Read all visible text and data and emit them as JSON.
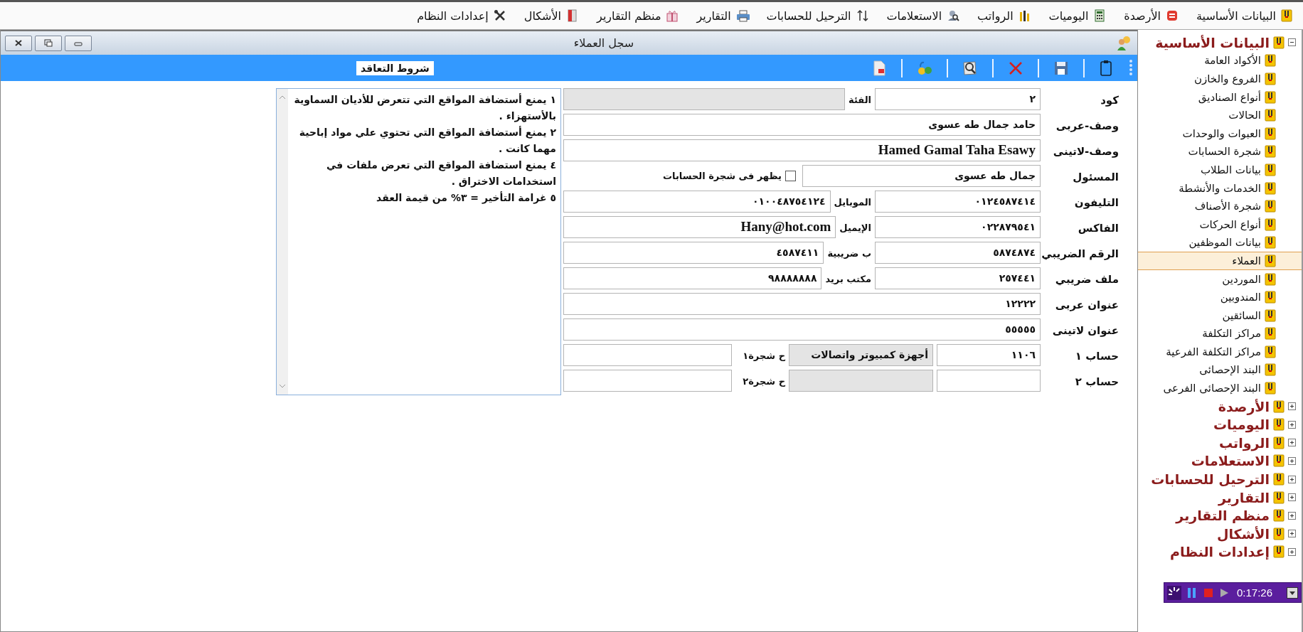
{
  "menu": [
    {
      "label": "البيانات الأساسية"
    },
    {
      "label": "الأرصدة"
    },
    {
      "label": "اليوميات"
    },
    {
      "label": "الرواتب"
    },
    {
      "label": "الاستعلامات"
    },
    {
      "label": "الترحيل للحسابات"
    },
    {
      "label": "التقارير"
    },
    {
      "label": "منظم التقارير"
    },
    {
      "label": "الأشكال"
    },
    {
      "label": "إعدادات النظام"
    }
  ],
  "window": {
    "title": "سجل العملاء"
  },
  "toolbar": {
    "section_label": "شروط التعاقد"
  },
  "form": {
    "rows": [
      {
        "kind": "pair",
        "label": "كود",
        "value": "٢",
        "side_label": "الفئة",
        "side_disabled": true
      },
      {
        "kind": "wide",
        "label": "وصف-عربى",
        "value": "حامد جمال طه عسوى"
      },
      {
        "kind": "wide",
        "label": "وصف-لاتينى",
        "value": "Hamed Gamal Taha Esawy",
        "latin": true
      },
      {
        "kind": "check",
        "label": "المسئول",
        "value": "جمال طه عسوى",
        "check_label": "يظهر فى شجرة الحسابات",
        "checked": false
      },
      {
        "kind": "pair",
        "label": "التليفون",
        "value": "٠١٢٤٥٨٧٤١٤",
        "side_label": "الموبايل",
        "side_value": "٠١٠٠٤٨٧٥٤١٢٤",
        "side_disabled": false
      },
      {
        "kind": "pair",
        "label": "الفاكس",
        "value": "٠٢٢٨٧٩٥٤١",
        "side_label": "الإيميل",
        "side_value": "Hany@hot.com",
        "side_latin": true,
        "side_disabled": false
      },
      {
        "kind": "pair",
        "label": "الرقم الضريبي",
        "value": "٥٨٧٤٨٧٤",
        "side_label": "ب ضريبية",
        "side_value": "٤٥٨٧٤١١",
        "side_disabled": false
      },
      {
        "kind": "pair",
        "label": "ملف ضريبي",
        "value": "٢٥٧٤٤١",
        "side_label": "مكتب بريد",
        "side_value": "٩٨٨٨٨٨٨٨",
        "side_disabled": false
      },
      {
        "kind": "wide",
        "label": "عنوان عربى",
        "value": "١٢٢٢٢"
      },
      {
        "kind": "wide",
        "label": "عنوان لاتينى",
        "value": "٥٥٥٥٥"
      },
      {
        "kind": "account",
        "label": "حساب ١",
        "value": "١١٠٦",
        "name": "أجهزة كمبيوتر واتصالات",
        "name_disabled": true,
        "tree_label": "ح شجرة١"
      },
      {
        "kind": "account",
        "label": "حساب ٢",
        "name_disabled": true,
        "tree_label": "ح شجرة٢"
      }
    ]
  },
  "terms": [
    "١ يمنع أستضافة المواقع التي تتعرض للأديان السماوية بالأستهزاء .",
    "٢ يمنع أستضافة المواقع التي تحتوي علي مواد إباحية مهما كانت .",
    "٤ يمنع استضافة المواقع التي تعرض ملفات في استخدامات الاختراق .",
    "٥ غرامة التأخير = ٣% من قيمة العقد"
  ],
  "sidebar": {
    "tree": [
      {
        "label": "البيانات الأساسية",
        "expanded": true,
        "selected": false,
        "children": [
          {
            "label": "الأكواد العامة",
            "selected": false
          },
          {
            "label": "الفروع والخازن",
            "selected": false
          },
          {
            "label": "أنواع الصناديق",
            "selected": false
          },
          {
            "label": "الحالات",
            "selected": false
          },
          {
            "label": "العبوات والوحدات",
            "selected": false
          },
          {
            "label": "شجرة الحسابات",
            "selected": false
          },
          {
            "label": "بيانات الطلاب",
            "selected": false
          },
          {
            "label": "الخدمات والأنشطة",
            "selected": false
          },
          {
            "label": "شجرة الأصناف",
            "selected": false
          },
          {
            "label": "أنواع الحركات",
            "selected": false
          },
          {
            "label": "بيانات الموظفين",
            "selected": false
          },
          {
            "label": "العملاء",
            "selected": true
          },
          {
            "label": "الموردين",
            "selected": false
          },
          {
            "label": "المندوبين",
            "selected": false
          },
          {
            "label": "السائقين",
            "selected": false
          },
          {
            "label": "مراكز التكلفة",
            "selected": false
          },
          {
            "label": "مراكز التكلفة الفرعية",
            "selected": false
          },
          {
            "label": "البند الإحصائى",
            "selected": false
          },
          {
            "label": "البند الإحصائى الفرعى",
            "selected": false
          }
        ]
      },
      {
        "label": "الأرصدة",
        "expanded": false,
        "selected": false
      },
      {
        "label": "اليوميات",
        "expanded": false,
        "selected": false
      },
      {
        "label": "الرواتب",
        "expanded": false,
        "selected": false
      },
      {
        "label": "الاستعلامات",
        "expanded": false,
        "selected": false
      },
      {
        "label": "الترحيل للحسابات",
        "expanded": false,
        "selected": false
      },
      {
        "label": "التقارير",
        "expanded": false,
        "selected": false
      },
      {
        "label": "منظم التقارير",
        "expanded": false,
        "selected": false
      },
      {
        "label": "الأشكال",
        "expanded": false,
        "selected": false
      },
      {
        "label": "إعدادات النظام",
        "expanded": false,
        "selected": false
      }
    ]
  },
  "recorder": {
    "time": "0:17:26"
  }
}
